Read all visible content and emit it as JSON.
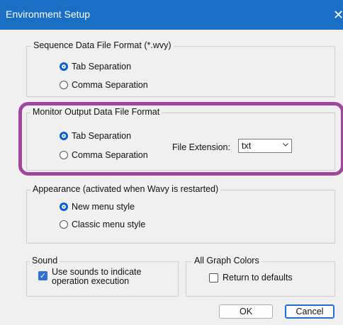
{
  "window": {
    "title": "Environment Setup",
    "close_glyph": "✕"
  },
  "sequence_group": {
    "label": "Sequence Data File Format (*.wvy)",
    "options": [
      {
        "label": "Tab Separation",
        "selected": true
      },
      {
        "label": "Comma Separation",
        "selected": false
      }
    ]
  },
  "monitor_group": {
    "label": "Monitor Output Data File Format",
    "options": [
      {
        "label": "Tab Separation",
        "selected": true
      },
      {
        "label": "Comma Separation",
        "selected": false
      }
    ],
    "extension_label": "File Extension:",
    "extension_value": "txt"
  },
  "appearance_group": {
    "label": "Appearance (activated when Wavy is restarted)",
    "options": [
      {
        "label": "New menu style",
        "selected": true
      },
      {
        "label": "Classic menu style",
        "selected": false
      }
    ]
  },
  "sound_group": {
    "label": "Sound",
    "checkbox_line1": "Use sounds to indicate",
    "checkbox_line2": "operation execution",
    "checked": true
  },
  "graph_colors_group": {
    "label": "All Graph Colors",
    "checkbox_label": "Return to defaults",
    "checked": false
  },
  "buttons": {
    "ok": "OK",
    "cancel": "Cancel"
  },
  "colors": {
    "titlebar": "#1a6fc4",
    "accent": "#0a5fd1",
    "highlight": "#a2459e"
  },
  "icons": {
    "radio_selected": "radio-on-icon",
    "radio_unselected": "radio-off-icon",
    "checkmark": "check-icon",
    "dropdown": "chevron-down-icon",
    "close": "close-icon"
  }
}
